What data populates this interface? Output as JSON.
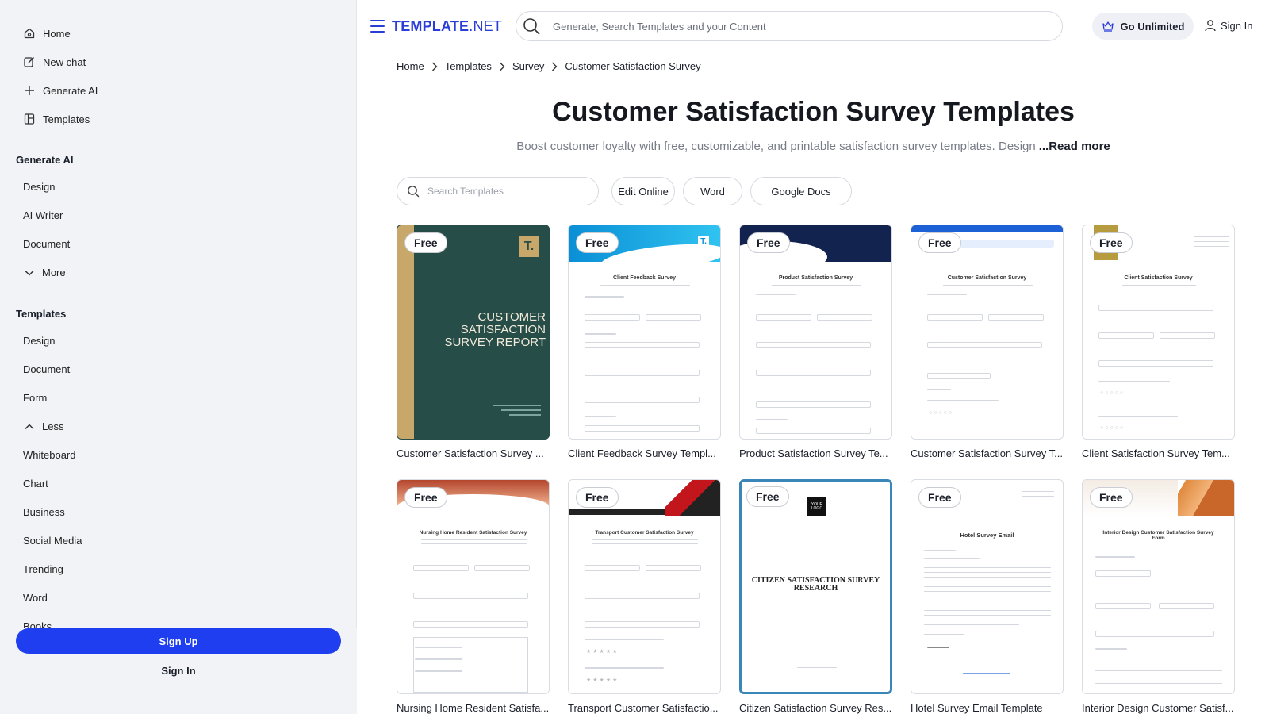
{
  "sidebar": {
    "top_items": [
      {
        "label": "Home",
        "icon": "home-icon"
      },
      {
        "label": "New chat",
        "icon": "edit-icon"
      },
      {
        "label": "Generate AI",
        "icon": "plus-icon"
      },
      {
        "label": "Templates",
        "icon": "templates-icon"
      }
    ],
    "generate_ai": {
      "heading": "Generate AI",
      "items": [
        "Design",
        "AI Writer",
        "Document"
      ],
      "more_label": "More"
    },
    "templates": {
      "heading": "Templates",
      "items": [
        "Design",
        "Document",
        "Form"
      ],
      "less_label": "Less",
      "extra_items": [
        "Whiteboard",
        "Chart",
        "Business",
        "Social Media",
        "Trending",
        "Word",
        "Books"
      ]
    },
    "signup_label": "Sign Up",
    "signin_label": "Sign In"
  },
  "header": {
    "logo_bold": "TEMPLATE",
    "logo_light": ".NET",
    "search_placeholder": "Generate, Search Templates and your Content",
    "go_unlimited_label": "Go Unlimited",
    "signin_label": "Sign In"
  },
  "breadcrumb": [
    "Home",
    "Templates",
    "Survey",
    "Customer Satisfaction Survey"
  ],
  "page": {
    "title": "Customer Satisfaction Survey Templates",
    "description": "Boost customer loyalty with free, customizable, and printable satisfaction survey templates. Design",
    "read_more": "...Read more"
  },
  "filters": {
    "search_placeholder": "Search Templates",
    "chips": [
      "Edit Online",
      "Word",
      "Google Docs"
    ]
  },
  "badge_label": "Free",
  "cards": [
    {
      "caption": "Customer Satisfaction Survey ...",
      "cover_title": "CUSTOMER SATISFACTION SURVEY REPORT"
    },
    {
      "caption": "Client Feedback Survey Templ...",
      "doc_title": "Client Feedback Survey"
    },
    {
      "caption": "Product Satisfaction Survey Te...",
      "doc_title": "Product Satisfaction Survey"
    },
    {
      "caption": "Customer Satisfaction Survey T...",
      "doc_title": "Customer Satisfaction Survey"
    },
    {
      "caption": "Client Satisfaction Survey Tem...",
      "doc_title": "Client Satisfaction Survey"
    },
    {
      "caption": "Nursing Home Resident Satisfa...",
      "doc_title": "Nursing Home Resident Satisfaction Survey"
    },
    {
      "caption": "Transport Customer Satisfactio...",
      "doc_title": "Transport Customer Satisfaction Survey"
    },
    {
      "caption": "Citizen Satisfaction Survey Res...",
      "cover_title": "CITIZEN SATISFACTION SURVEY RESEARCH",
      "logo_text": "YOUR LOGO"
    },
    {
      "caption": "Hotel Survey Email Template",
      "doc_title": "Hotel Survey Email"
    },
    {
      "caption": "Interior Design Customer Satisf...",
      "doc_title": "Interior Design Customer Satisfaction Survey Form"
    }
  ],
  "colors": {
    "accent": "#1f3ef0",
    "logo": "#2a3dd6",
    "sidebar_bg": "#f1f3f7"
  }
}
